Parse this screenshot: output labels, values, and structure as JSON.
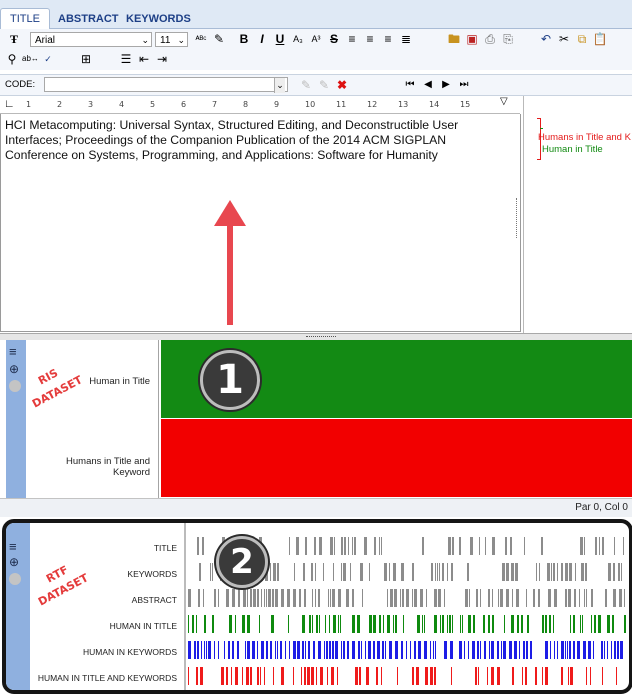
{
  "tabs": [
    {
      "label": "TITLE"
    },
    {
      "label": "ABSTRACT"
    },
    {
      "label": "KEYWORDS"
    }
  ],
  "toolbar": {
    "font_name": "Arial",
    "font_size": "11",
    "code_label": "CODE:",
    "code_value": ""
  },
  "ruler": [
    "1",
    "2",
    "3",
    "4",
    "5",
    "6",
    "7",
    "8",
    "9",
    "10",
    "11",
    "12",
    "13",
    "14",
    "15"
  ],
  "editor": {
    "text": "HCI Metacomputing: Universal Syntax, Structured Editing, and Deconstructible User Interfaces; Proceedings of the Companion Publication of the 2014 ACM SIGPLAN Conference on Systems, Programming, and Applications: Software for Humanity"
  },
  "side_codes": [
    {
      "label": "Humans in Title and K",
      "color": "#e41b1b"
    },
    {
      "label": "Human in Title",
      "color": "#118a11"
    }
  ],
  "ris": {
    "labels": [
      "Human in Title",
      "Humans in Title and Keyword"
    ],
    "annotation_line1": "RIS",
    "annotation_line2": "DATASET",
    "badge": "1",
    "colors": {
      "green": "#138a14",
      "red": "#f20000"
    }
  },
  "status": {
    "text": "Par 0, Col 0"
  },
  "rtf": {
    "annotation_line1": "RTF",
    "annotation_line2": "DATASET",
    "badge": "2",
    "rows": [
      {
        "label": "TITLE",
        "color": "#8c8c8c"
      },
      {
        "label": "KEYWORDS",
        "color": "#8c8c8c"
      },
      {
        "label": "ABSTRACT",
        "color": "#8c8c8c"
      },
      {
        "label": "HUMAN IN TITLE",
        "color": "#0f8a0f"
      },
      {
        "label": "HUMAN IN KEYWORDS",
        "color": "#1d1de6"
      },
      {
        "label": "HUMAN IN TITLE AND KEYWORDS",
        "color": "#ef1b1b"
      }
    ]
  }
}
